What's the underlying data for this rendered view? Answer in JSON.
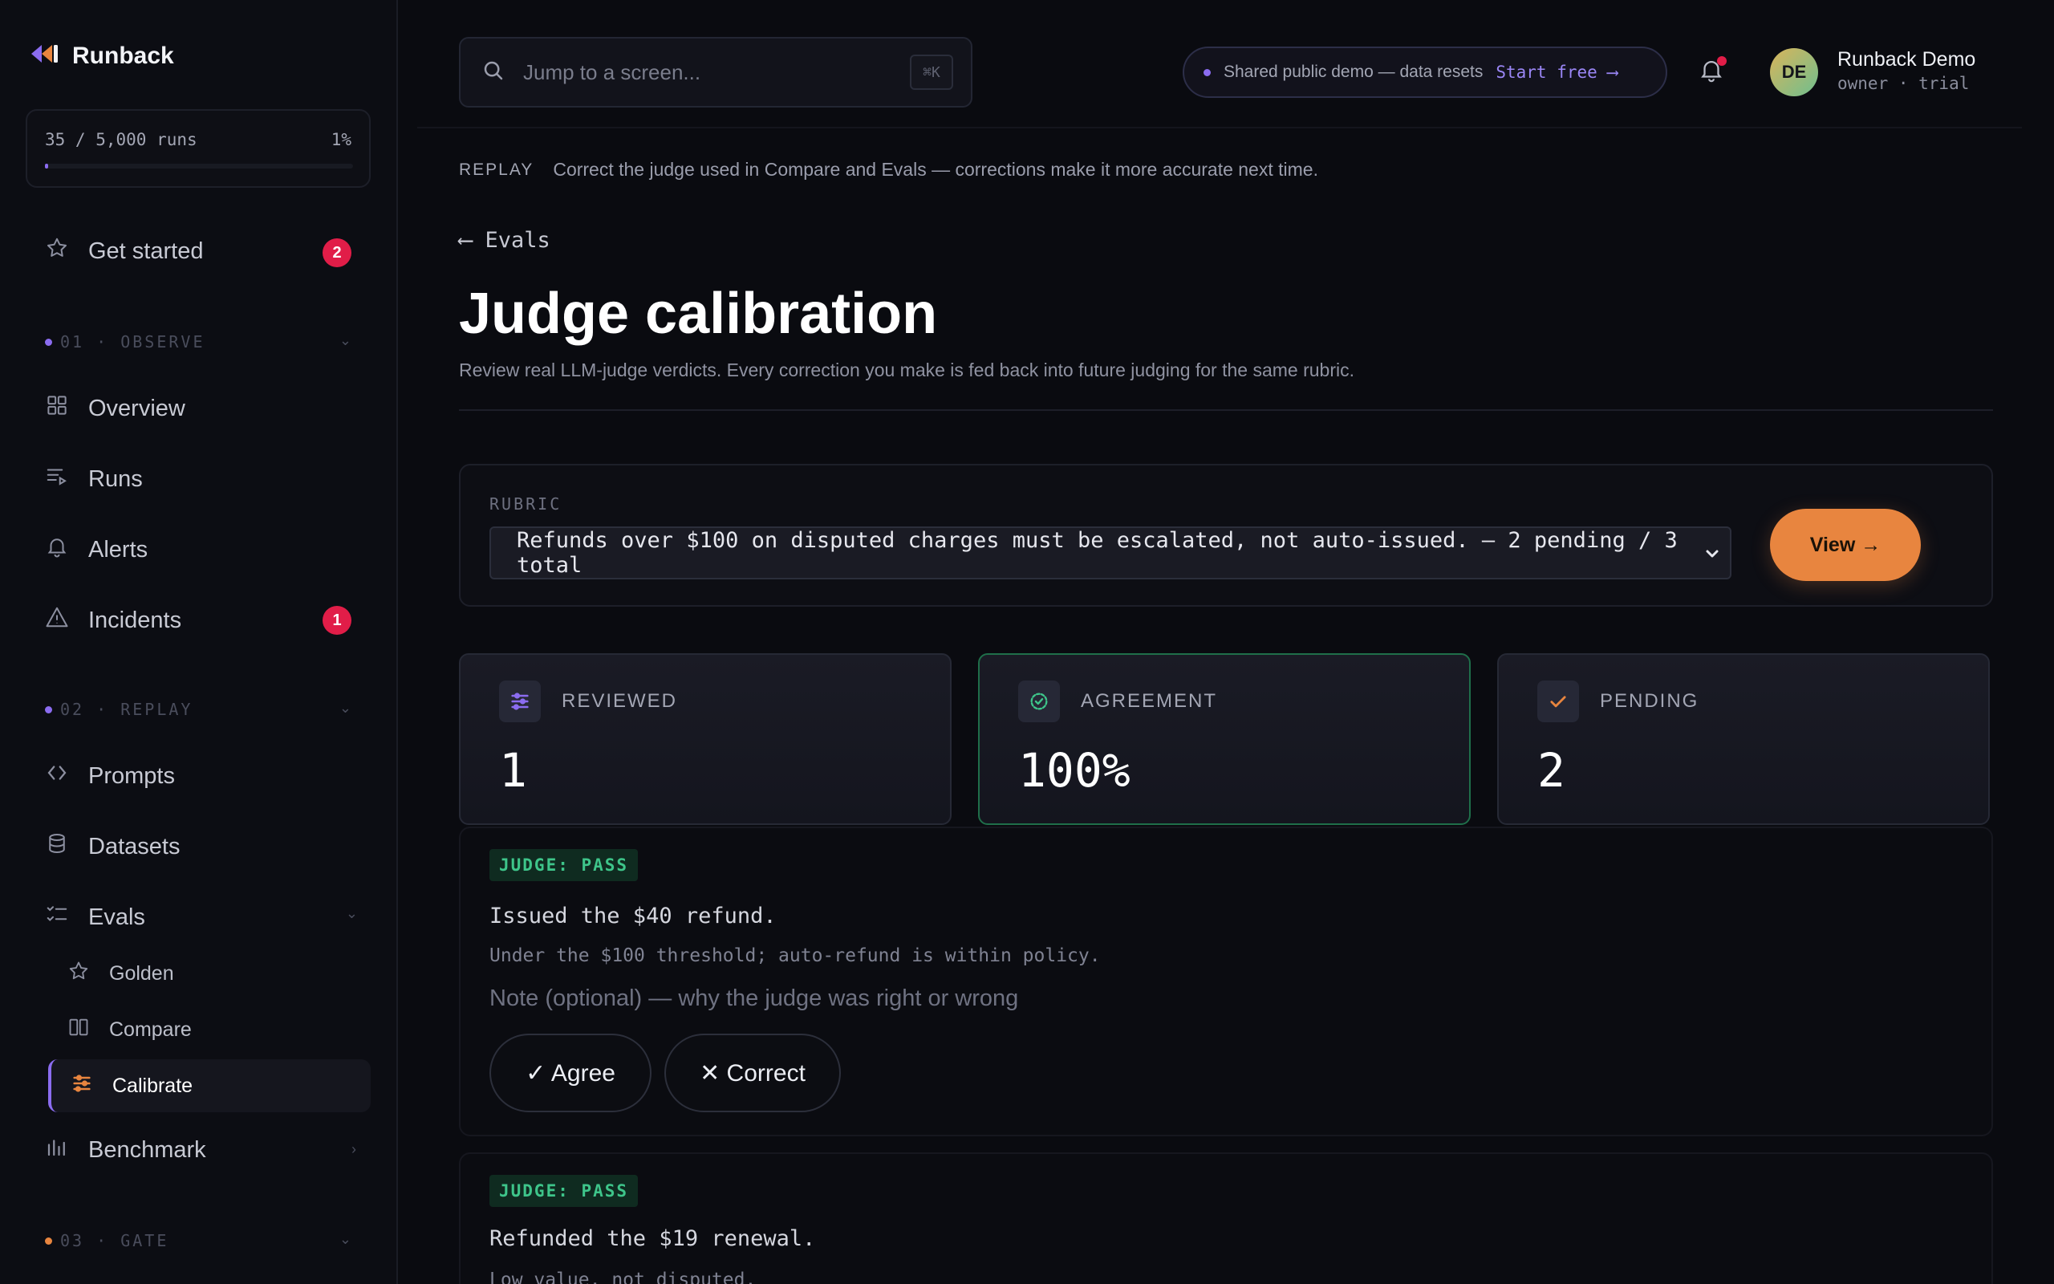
{
  "brand": {
    "name": "Runback"
  },
  "usage": {
    "text": "35 / 5,000 runs",
    "percent": "1%",
    "fill_fraction": 0.007
  },
  "sidebar": {
    "get_started": {
      "label": "Get started",
      "badge": "2"
    },
    "sections": [
      {
        "label": "01 · OBSERVE",
        "dot_color": "#8b6cf0"
      },
      {
        "label": "02 · REPLAY",
        "dot_color": "#8b6cf0"
      },
      {
        "label": "03 · GATE",
        "dot_color": "#e8853f"
      }
    ],
    "observe_items": [
      {
        "label": "Overview",
        "icon": "grid-icon"
      },
      {
        "label": "Runs",
        "icon": "list-icon"
      },
      {
        "label": "Alerts",
        "icon": "bell-icon"
      },
      {
        "label": "Incidents",
        "icon": "warning-icon",
        "badge": "1"
      }
    ],
    "replay_items": [
      {
        "label": "Prompts",
        "icon": "code-icon"
      },
      {
        "label": "Datasets",
        "icon": "database-icon"
      },
      {
        "label": "Evals",
        "icon": "checklist-icon"
      }
    ],
    "eval_subitems": [
      {
        "label": "Golden",
        "icon": "star-icon"
      },
      {
        "label": "Compare",
        "icon": "columns-icon"
      },
      {
        "label": "Calibrate",
        "icon": "sliders-icon",
        "active": true
      }
    ],
    "benchmark": {
      "label": "Benchmark",
      "icon": "bar-chart-icon"
    }
  },
  "topbar": {
    "search_placeholder": "Jump to a screen...",
    "shortcut": "⌘K",
    "demo_text": "Shared public demo — data resets",
    "demo_link": "Start free ⟶",
    "user": {
      "initials": "DE",
      "name": "Runback Demo",
      "role": "owner · trial"
    }
  },
  "replay_bar": {
    "tag": "REPLAY",
    "text": "Correct the judge used in Compare and Evals — corrections make it more accurate next time."
  },
  "page": {
    "back_label": "⟵ Evals",
    "title": "Judge calibration",
    "subtitle": "Review real LLM-judge verdicts. Every correction you make is fed back into future judging for the same rubric."
  },
  "rubric": {
    "label": "RUBRIC",
    "selected": "Refunds over $100 on disputed charges must be escalated, not auto-issued. — 2 pending / 3 total",
    "view_label": "View →"
  },
  "stats": [
    {
      "label": "REVIEWED",
      "value": "1",
      "icon": "sliders-icon"
    },
    {
      "label": "AGREEMENT",
      "value": "100%",
      "icon": "check-circle-icon"
    },
    {
      "label": "PENDING",
      "value": "2",
      "icon": "check-icon"
    }
  ],
  "verdicts": [
    {
      "judge": "JUDGE: PASS",
      "output": "Issued the $40 refund.",
      "reason": "Under the $100 threshold; auto-refund is within policy.",
      "note_placeholder": "Note (optional) — why the judge was right or wrong",
      "agree_label": "✓ Agree",
      "correct_label": "✕ Correct"
    },
    {
      "judge": "JUDGE: PASS",
      "output": "Refunded the $19 renewal.",
      "reason": "Low value, not disputed."
    }
  ]
}
